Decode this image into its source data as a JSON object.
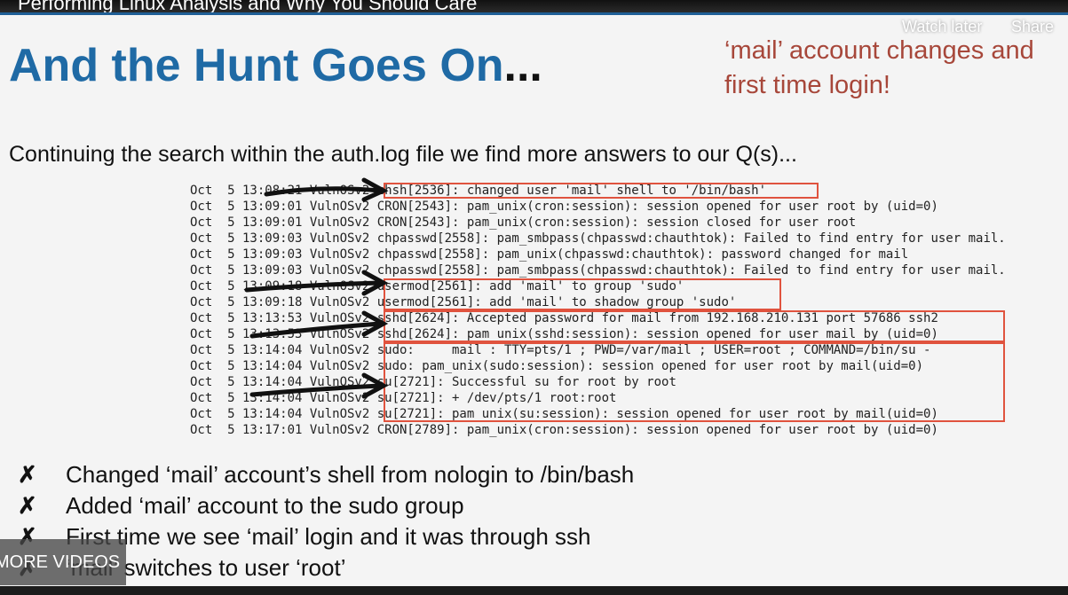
{
  "video": {
    "title": "Performing Linux Analysis and Why You Should Care",
    "watch_later_label": "Watch later",
    "share_label": "Share",
    "more_videos_label": "MORE VIDEOS"
  },
  "slide": {
    "title_main": "And the Hunt Goes On",
    "title_dots": "...",
    "callout": "‘mail’ account changes and first time login!",
    "intro": "Continuing the search within the auth.log file we find more answers to our Q(s)...",
    "log_lines": [
      "Oct  5 13:08:21 VulnOSv2 chsh[2536]: changed user 'mail' shell to '/bin/bash'",
      "Oct  5 13:09:01 VulnOSv2 CRON[2543]: pam_unix(cron:session): session opened for user root by (uid=0)",
      "Oct  5 13:09:01 VulnOSv2 CRON[2543]: pam_unix(cron:session): session closed for user root",
      "Oct  5 13:09:03 VulnOSv2 chpasswd[2558]: pam_smbpass(chpasswd:chauthtok): Failed to find entry for user mail.",
      "Oct  5 13:09:03 VulnOSv2 chpasswd[2558]: pam_unix(chpasswd:chauthtok): password changed for mail",
      "Oct  5 13:09:03 VulnOSv2 chpasswd[2558]: pam_smbpass(chpasswd:chauthtok): Failed to find entry for user mail.",
      "Oct  5 13:09:18 VulnOSv2 usermod[2561]: add 'mail' to group 'sudo'",
      "Oct  5 13:09:18 VulnOSv2 usermod[2561]: add 'mail' to shadow group 'sudo'",
      "Oct  5 13:13:53 VulnOSv2 sshd[2624]: Accepted password for mail from 192.168.210.131 port 57686 ssh2",
      "Oct  5 13:13:53 VulnOSv2 sshd[2624]: pam_unix(sshd:session): session opened for user mail by (uid=0)",
      "Oct  5 13:14:04 VulnOSv2 sudo:     mail : TTY=pts/1 ; PWD=/var/mail ; USER=root ; COMMAND=/bin/su -",
      "Oct  5 13:14:04 VulnOSv2 sudo: pam_unix(sudo:session): session opened for user root by mail(uid=0)",
      "Oct  5 13:14:04 VulnOSv2 su[2721]: Successful su for root by root",
      "Oct  5 13:14:04 VulnOSv2 su[2721]: + /dev/pts/1 root:root",
      "Oct  5 13:14:04 VulnOSv2 su[2721]: pam_unix(su:session): session opened for user root by mail(uid=0)",
      "Oct  5 13:17:01 VulnOSv2 CRON[2789]: pam_unix(cron:session): session opened for user root by (uid=0)"
    ],
    "bullets": [
      "Changed ‘mail’ account’s shell from nologin to /bin/bash",
      "Added ‘mail’ account to the sudo group",
      "First time we see ‘mail’ login and it was through ssh",
      "‘mail’ switches to user ‘root’"
    ],
    "bullet_marker": "✗"
  },
  "colors": {
    "title_blue": "#1f6aa5",
    "callout_red": "#a7473a",
    "highlight_border": "#e0533e"
  }
}
